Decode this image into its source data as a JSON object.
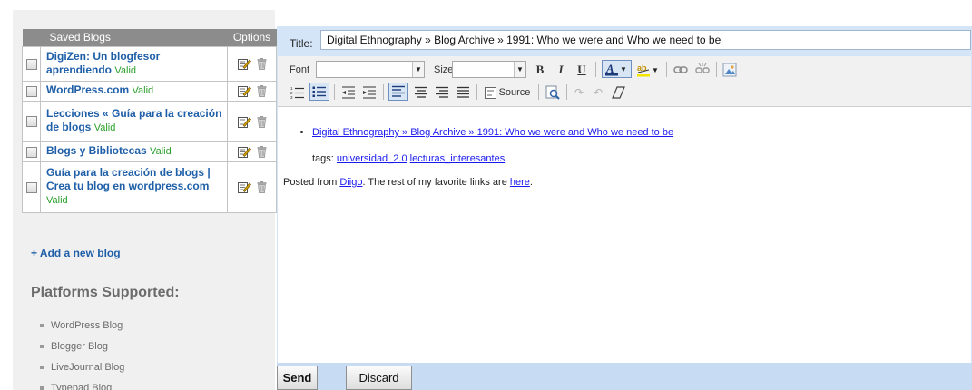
{
  "blogs_table": {
    "header_name": "Saved Blogs",
    "header_options": "Options",
    "rows": [
      {
        "name": "DigiZen: Un blogfesor aprendiendo",
        "status": "Valid"
      },
      {
        "name": "WordPress.com",
        "status": "Valid"
      },
      {
        "name": "Lecciones « Guía para la creación de blogs",
        "status": "Valid"
      },
      {
        "name": "Blogs y Bibliotecas",
        "status": "Valid"
      },
      {
        "name": "Guía para la creación de blogs | Crea tu blog en wordpress.com",
        "status": "Valid"
      }
    ]
  },
  "sidebar": {
    "add_blog": "+ Add a new blog",
    "platforms_title": "Platforms Supported:",
    "platforms": [
      "WordPress Blog",
      "Blogger Blog",
      "LiveJournal Blog",
      "Typepad Blog"
    ]
  },
  "editor": {
    "title_label": "Title:",
    "title_value": "Digital Ethnography » Blog Archive » 1991: Who we were and Who we need to be",
    "toolbar": {
      "font_label": "Font",
      "size_label": "Size",
      "source_label": "Source",
      "bold": "B",
      "italic": "I",
      "underline": "U"
    },
    "content": {
      "link_text": "Digital Ethnography » Blog Archive » 1991: Who we were and Who we need to be",
      "tags_prefix": "tags:",
      "tag1": "universidad_2.0",
      "tag2": "lecturas_interesantes",
      "posted_prefix": "Posted from",
      "posted_link": "Diigo",
      "posted_middle": ". The rest of my favorite links are",
      "posted_here": "here",
      "posted_end": "."
    },
    "send_label": "Send",
    "discard_label": "Discard"
  },
  "colors": {
    "header_gray": "#8c8c8c",
    "link_blue": "#1f5fa8",
    "valid_green": "#2aa02a",
    "editor_bg": "#d4e5f8"
  },
  "icons": {
    "edit": "edit-icon",
    "delete": "trash-icon"
  }
}
